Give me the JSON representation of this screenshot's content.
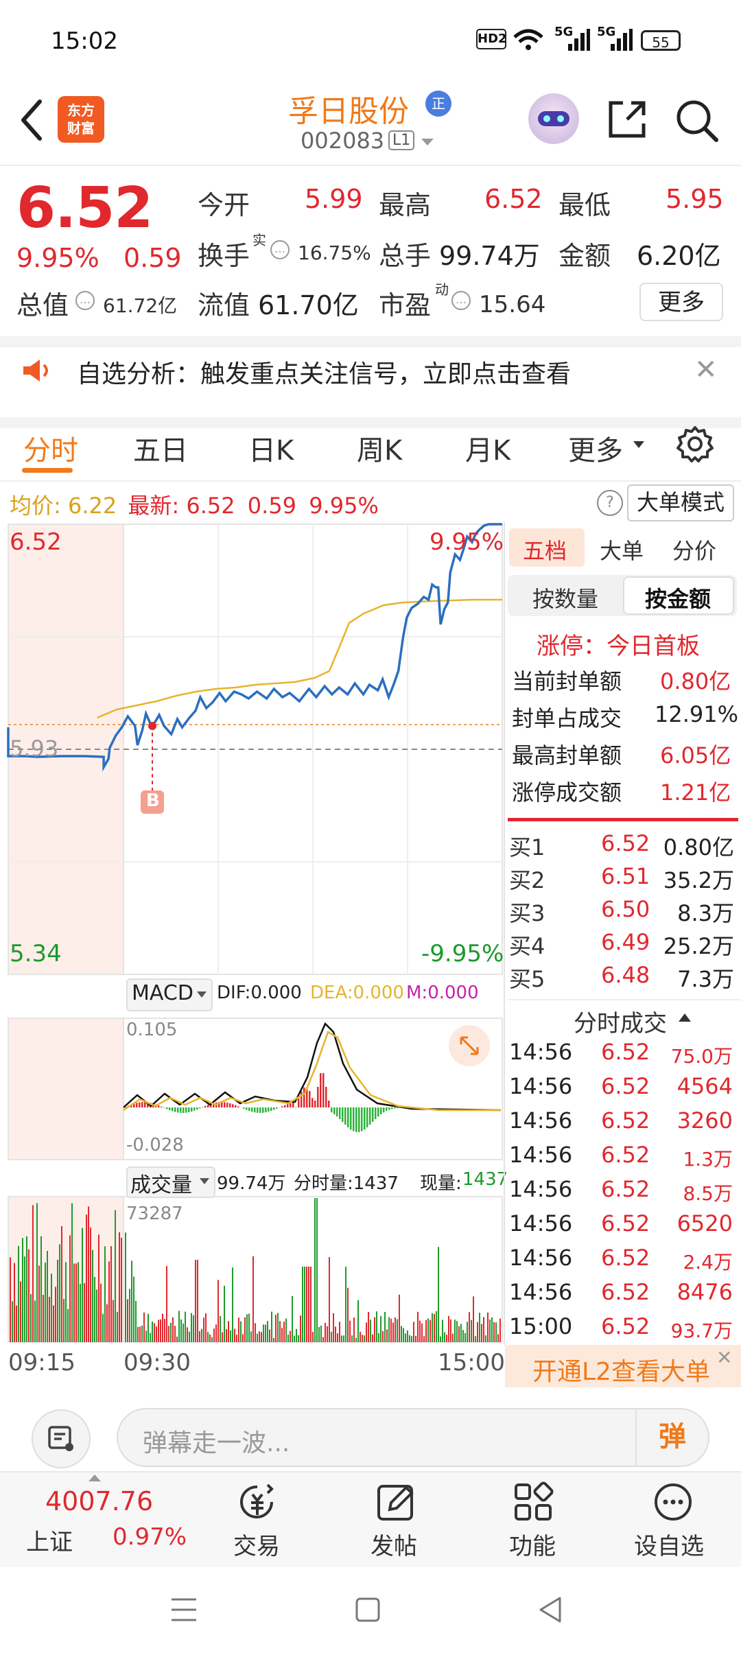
{
  "status_bar": {
    "time": "15:02",
    "hd": "HD2",
    "sig1": "5G",
    "sig2": "5G",
    "battery": "55"
  },
  "header": {
    "logo_line1": "东方",
    "logo_line2": "财富",
    "stock_name": "孚日股份",
    "badge": "正",
    "stock_code": "002083",
    "level": "L1"
  },
  "quote": {
    "price": "6.52",
    "change_pct": "9.95%",
    "change": "0.59",
    "open_label": "今开",
    "open": "5.99",
    "high_label": "最高",
    "high": "6.52",
    "low_label": "最低",
    "low": "5.95",
    "turnover_label": "换手",
    "turnover_sup": "实",
    "turnover": "16.75%",
    "volume_label": "总手",
    "volume": "99.74万",
    "amount_label": "金额",
    "amount": "6.20亿",
    "mcap_label": "总值",
    "mcap": "61.72亿",
    "float_label": "流值",
    "float": "61.70亿",
    "pe_label": "市盈",
    "pe_sup": "动",
    "pe": "15.64",
    "more": "更多"
  },
  "alert": {
    "text": "自选分析：触发重点关注信号，立即点击查看"
  },
  "tabs": [
    "分时",
    "五日",
    "日K",
    "周K",
    "月K",
    "更多"
  ],
  "chart_header": {
    "avg_label": "均价:",
    "avg": "6.22",
    "latest_label": "最新:",
    "latest": "6.52",
    "latest_chg": "0.59",
    "latest_pct": "9.95%",
    "big_mode": "大单模式"
  },
  "price_chart": {
    "y_top": "6.52",
    "y_mid": "5.93",
    "y_bottom": "5.34",
    "pct_top": "9.95%",
    "pct_bottom": "-9.95%",
    "buy_marker": "B"
  },
  "macd": {
    "label": "MACD",
    "dif": "DIF:0.000",
    "dea": "DEA:0.000",
    "m": "M:0.000",
    "top": "0.105",
    "bottom": "-0.028"
  },
  "volume": {
    "label": "成交量",
    "total": "99.74万",
    "min_label": "分时量:1437",
    "now_label": "现量:",
    "now": "1437",
    "top": "73287"
  },
  "x_axis": [
    "09:15",
    "09:30",
    "15:00"
  ],
  "right_panel": {
    "tabs": [
      "五档",
      "大单",
      "分价"
    ],
    "seg": [
      "按数量",
      "按金额"
    ],
    "limit_label": "涨停：今日首板",
    "stats": [
      {
        "label": "当前封单额",
        "value": "0.80亿"
      },
      {
        "label": "封单占成交",
        "value": "12.91%"
      },
      {
        "label": "最高封单额",
        "value": "6.05亿"
      },
      {
        "label": "涨停成交额",
        "value": "1.21亿"
      }
    ],
    "bids": [
      {
        "label": "买1",
        "price": "6.52",
        "vol": "0.80亿"
      },
      {
        "label": "买2",
        "price": "6.51",
        "vol": "35.2万"
      },
      {
        "label": "买3",
        "price": "6.50",
        "vol": "8.3万"
      },
      {
        "label": "买4",
        "price": "6.49",
        "vol": "25.2万"
      },
      {
        "label": "买5",
        "price": "6.48",
        "vol": "7.3万"
      }
    ],
    "ticks_title": "分时成交",
    "ticks": [
      {
        "t": "14:56",
        "p": "6.52",
        "v": "75.0万"
      },
      {
        "t": "14:56",
        "p": "6.52",
        "v": "4564"
      },
      {
        "t": "14:56",
        "p": "6.52",
        "v": "3260"
      },
      {
        "t": "14:56",
        "p": "6.52",
        "v": "1.3万"
      },
      {
        "t": "14:56",
        "p": "6.52",
        "v": "8.5万"
      },
      {
        "t": "14:56",
        "p": "6.52",
        "v": "6520"
      },
      {
        "t": "14:56",
        "p": "6.52",
        "v": "2.4万"
      },
      {
        "t": "14:56",
        "p": "6.52",
        "v": "8476"
      },
      {
        "t": "15:00",
        "p": "6.52",
        "v": "93.7万"
      }
    ],
    "l2": "开通L2查看大单"
  },
  "input": {
    "placeholder": "弹幕走一波...",
    "danmu": "弹"
  },
  "bottom_nav": {
    "index_value": "4007.76",
    "index_name": "上证",
    "index_pct": "0.97%",
    "items": [
      "交易",
      "发帖",
      "功能",
      "设自选"
    ]
  },
  "colors": {
    "up": "#e0282e",
    "down": "#1a9a2a",
    "accent": "#f07a1a",
    "price_line": "#2a6fc0",
    "avg_line": "#e6b52a"
  }
}
